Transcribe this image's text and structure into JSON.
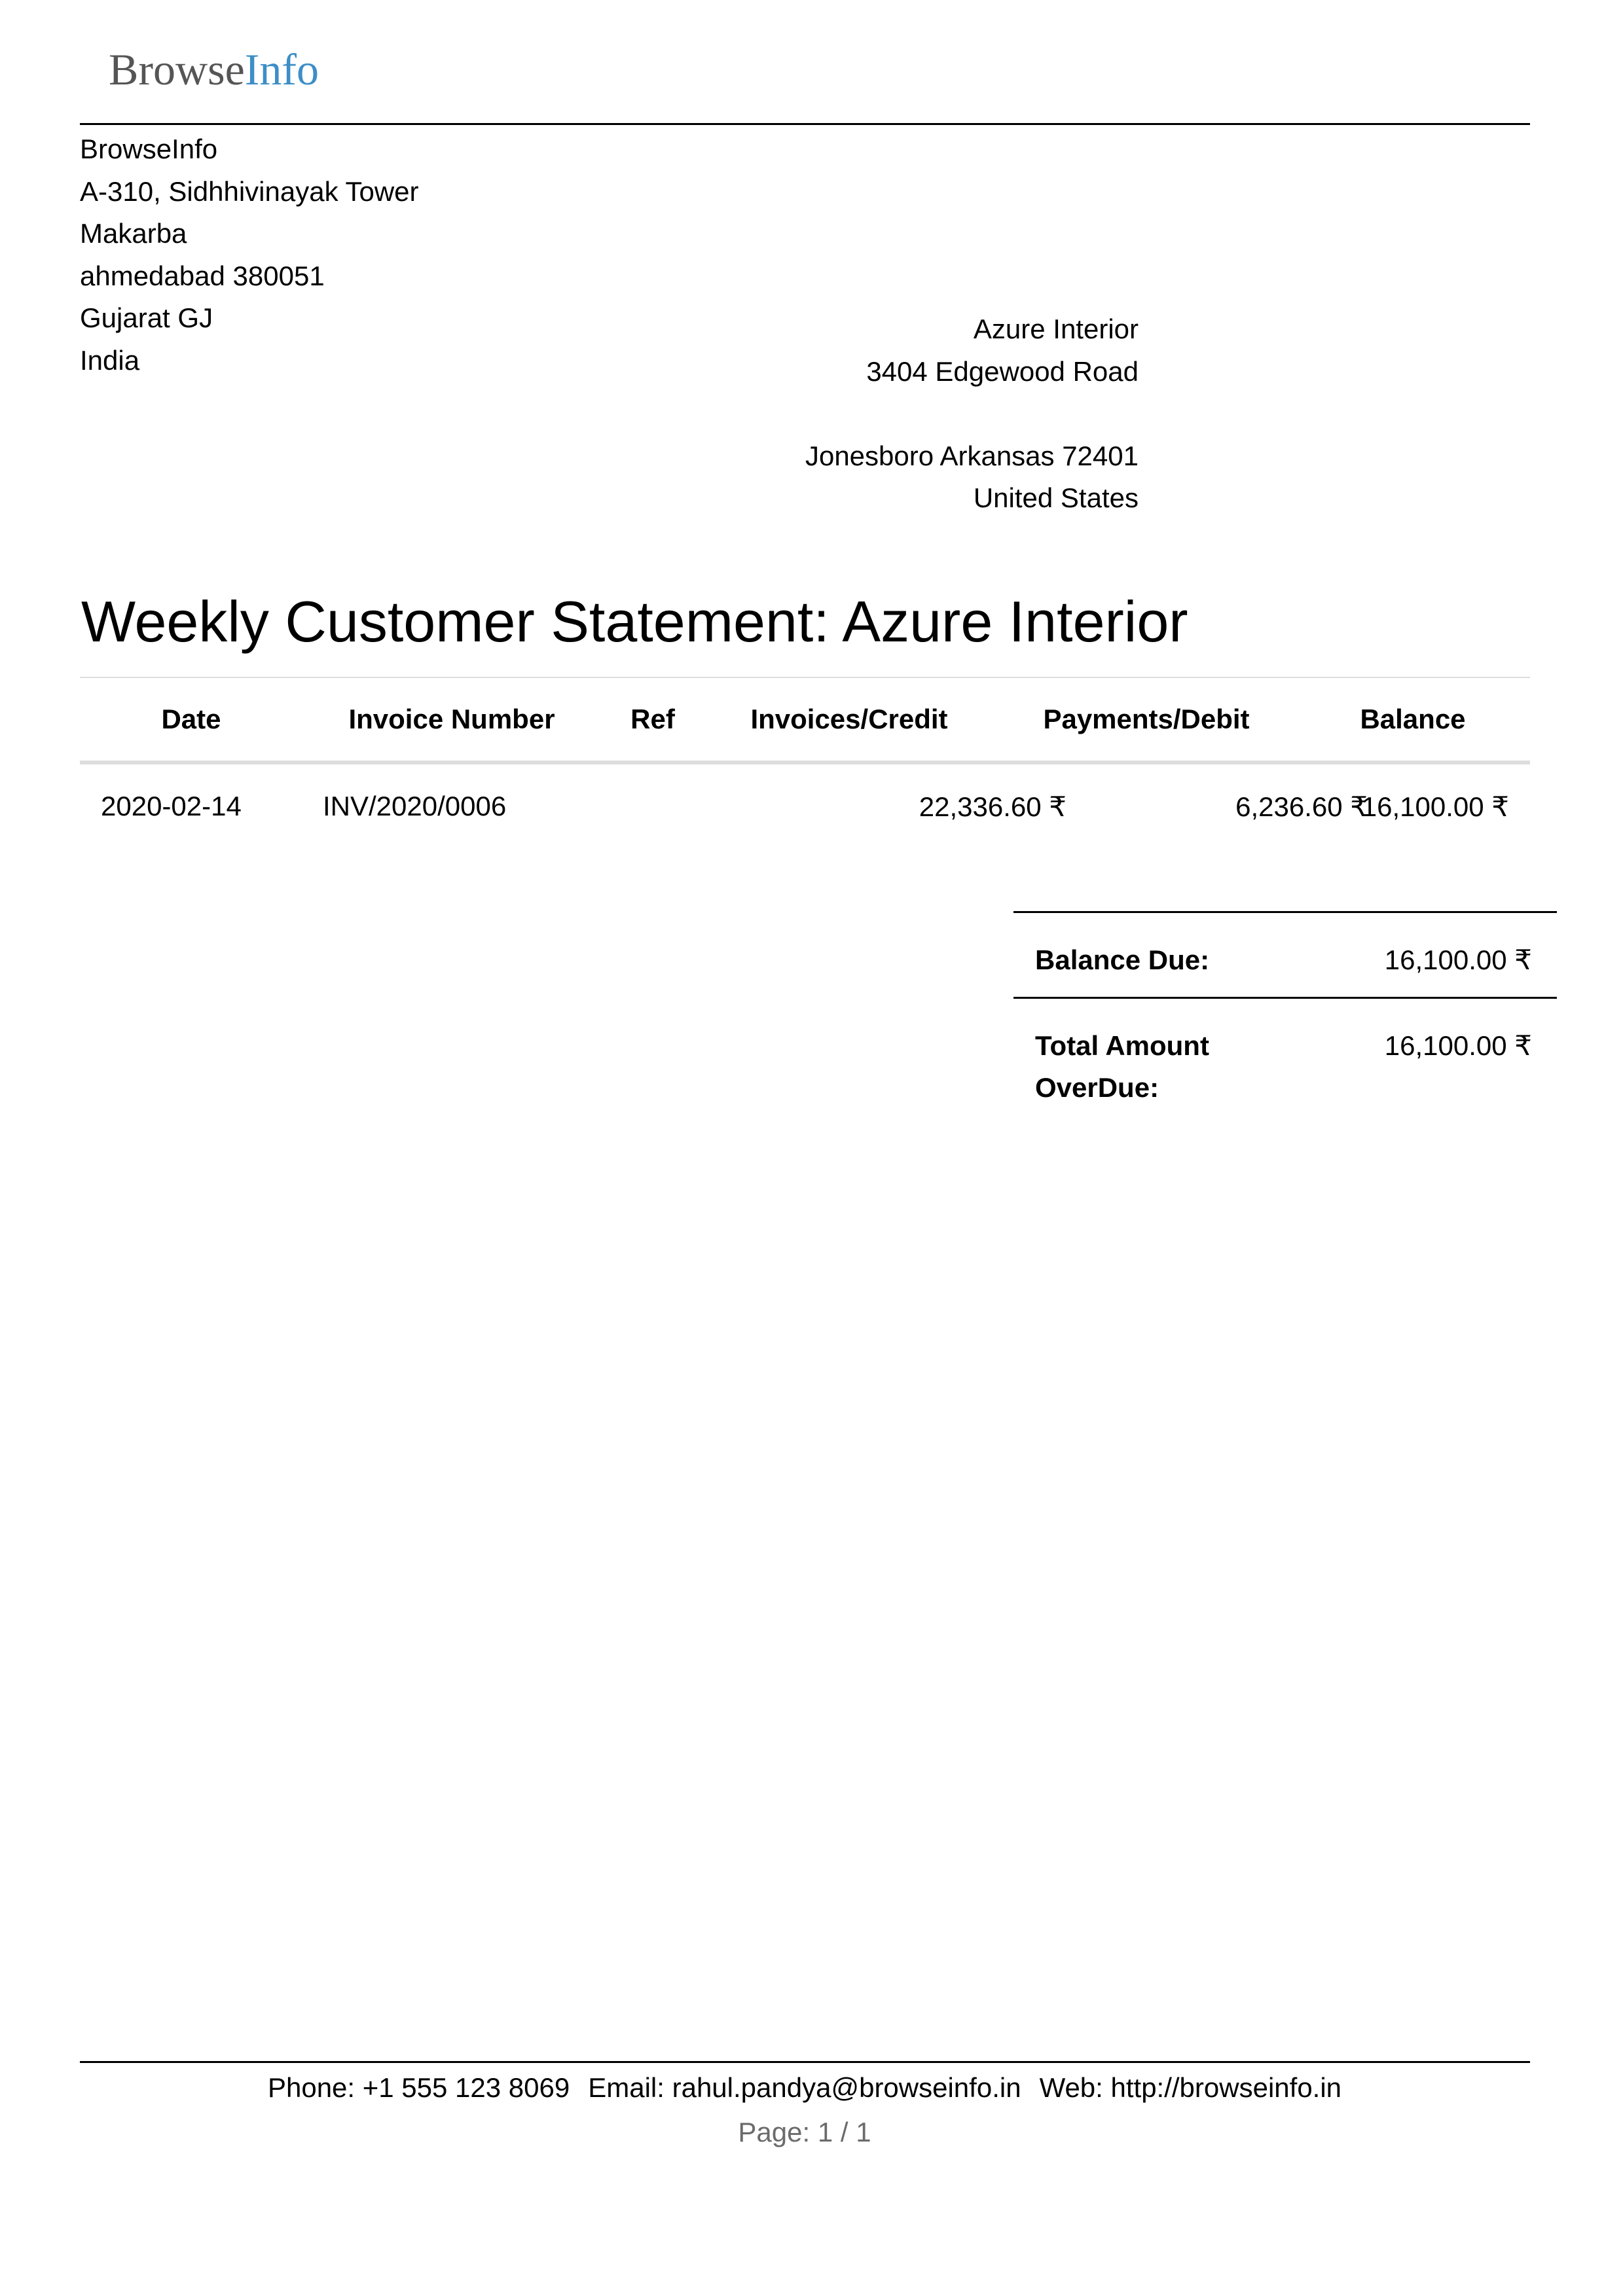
{
  "logo": {
    "part1": "Browse",
    "part2": "Info",
    "color_part1": "#555555",
    "color_part2": "#3d8ec7"
  },
  "company_address": {
    "name": "BrowseInfo",
    "line1": "A-310, Sidhhivinayak Tower",
    "line2": "Makarba",
    "line3": "ahmedabad 380051",
    "line4": "Gujarat GJ",
    "line5": "India"
  },
  "partner_address": {
    "name": "Azure Interior",
    "line1": "3404 Edgewood Road",
    "line2": "",
    "line3": "Jonesboro Arkansas 72401",
    "line4": "United States"
  },
  "title": "Weekly Customer Statement: Azure Interior",
  "table": {
    "headers": {
      "date": "Date",
      "invoice_number": "Invoice Number",
      "ref": "Ref",
      "invoices_credit": "Invoices/Credit",
      "payments_debit": "Payments/Debit",
      "balance": "Balance"
    },
    "rows": [
      {
        "date": "2020-02-14",
        "invoice_number": "INV/2020/0006",
        "ref": "",
        "invoices_credit": "22,336.60 ₹",
        "payments_debit": "6,236.60 ₹",
        "balance": "16,100.00 ₹"
      }
    ]
  },
  "totals": {
    "balance_due_label": "Balance Due:",
    "balance_due_value": "16,100.00 ₹",
    "total_overdue_label": "Total Amount OverDue:",
    "total_overdue_value": "16,100.00 ₹"
  },
  "footer": {
    "phone": "Phone: +1 555 123 8069",
    "email": "Email: rahul.pandya@browseinfo.in",
    "web": "Web: http://browseinfo.in",
    "page": "Page: 1 / 1"
  }
}
